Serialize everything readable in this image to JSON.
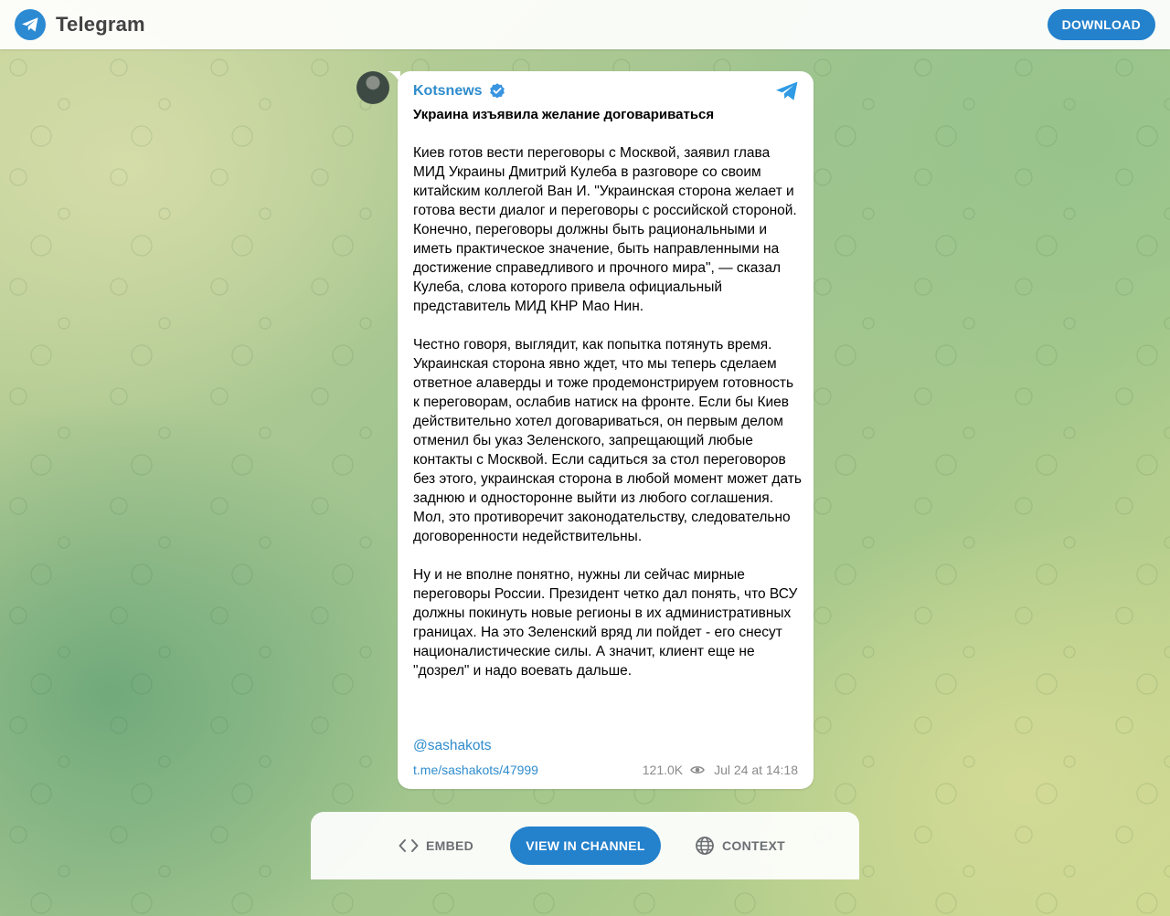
{
  "app": {
    "name": "Telegram",
    "download_label": "DOWNLOAD"
  },
  "post": {
    "channel_name": "Kotsnews",
    "verified": true,
    "title": "Украина изъявила желание договариваться",
    "paragraphs": [
      "Киев готов вести переговоры с Москвой, заявил глава МИД Украины Дмитрий Кулеба в разговоре со своим китайским коллегой Ван И. \"Украинская сторона желает и готова вести диалог и переговоры с российской стороной. Конечно, переговоры должны быть рациональными и иметь практическое значение, быть направленными на достижение справедливого и прочного мира\", — сказал Кулеба, слова которого привела официальный представитель МИД КНР Мао Нин.",
      "Честно говоря, выглядит, как попытка потянуть время. Украинская сторона явно ждет, что мы теперь сделаем ответное алаверды и тоже продемонстрируем готовность к переговорам, ослабив натиск на фронте. Если бы Киев действительно хотел договариваться, он первым делом отменил бы указ Зеленского, запрещающий любые контакты с Москвой. Если садиться за стол переговоров без этого, украинская сторона в любой момент может дать заднюю и односторонне выйти из любого соглашения. Мол, это противоречит законодательству, следовательно договоренности недействительны.",
      "Ну и не вполне понятно, нужны ли сейчас мирные переговоры России. Президент четко дал понять, что ВСУ должны покинуть новые регионы в их административных границах. На это Зеленский вряд ли пойдет - его снесут националистические силы. А значит, клиент еще не \"дозрел\" и надо воевать дальше."
    ],
    "mention": "@sashakots",
    "link": "t.me/sashakots/47999",
    "views": "121.0K",
    "date": "Jul 24 at 14:18"
  },
  "actions": {
    "embed_label": "EMBED",
    "view_label": "VIEW IN CHANNEL",
    "context_label": "CONTEXT"
  },
  "colors": {
    "accent": "#2481cc",
    "link": "#2f8ccc",
    "muted": "#8a8a8a"
  },
  "icons": {
    "brand": "telegram-logo-icon",
    "verified": "verified-badge-icon",
    "corner": "telegram-plane-icon",
    "views": "eye-icon",
    "embed": "code-brackets-icon",
    "context": "globe-icon"
  }
}
